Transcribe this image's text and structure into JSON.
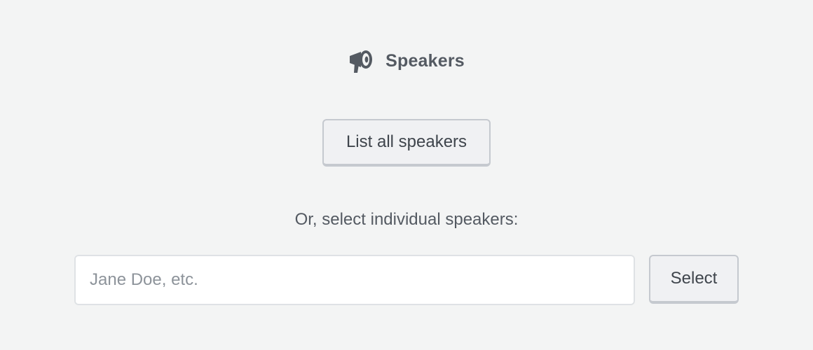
{
  "header": {
    "icon": "megaphone-icon",
    "title": "Speakers"
  },
  "actions": {
    "list_all_label": "List all speakers"
  },
  "select_section": {
    "label": "Or, select individual speakers:",
    "input_placeholder": "Jane Doe, etc.",
    "input_value": "",
    "select_label": "Select"
  },
  "colors": {
    "background": "#f3f4f4",
    "text": "#545a62",
    "button_bg": "#f0f1f3",
    "button_border": "#c5c9cf"
  }
}
